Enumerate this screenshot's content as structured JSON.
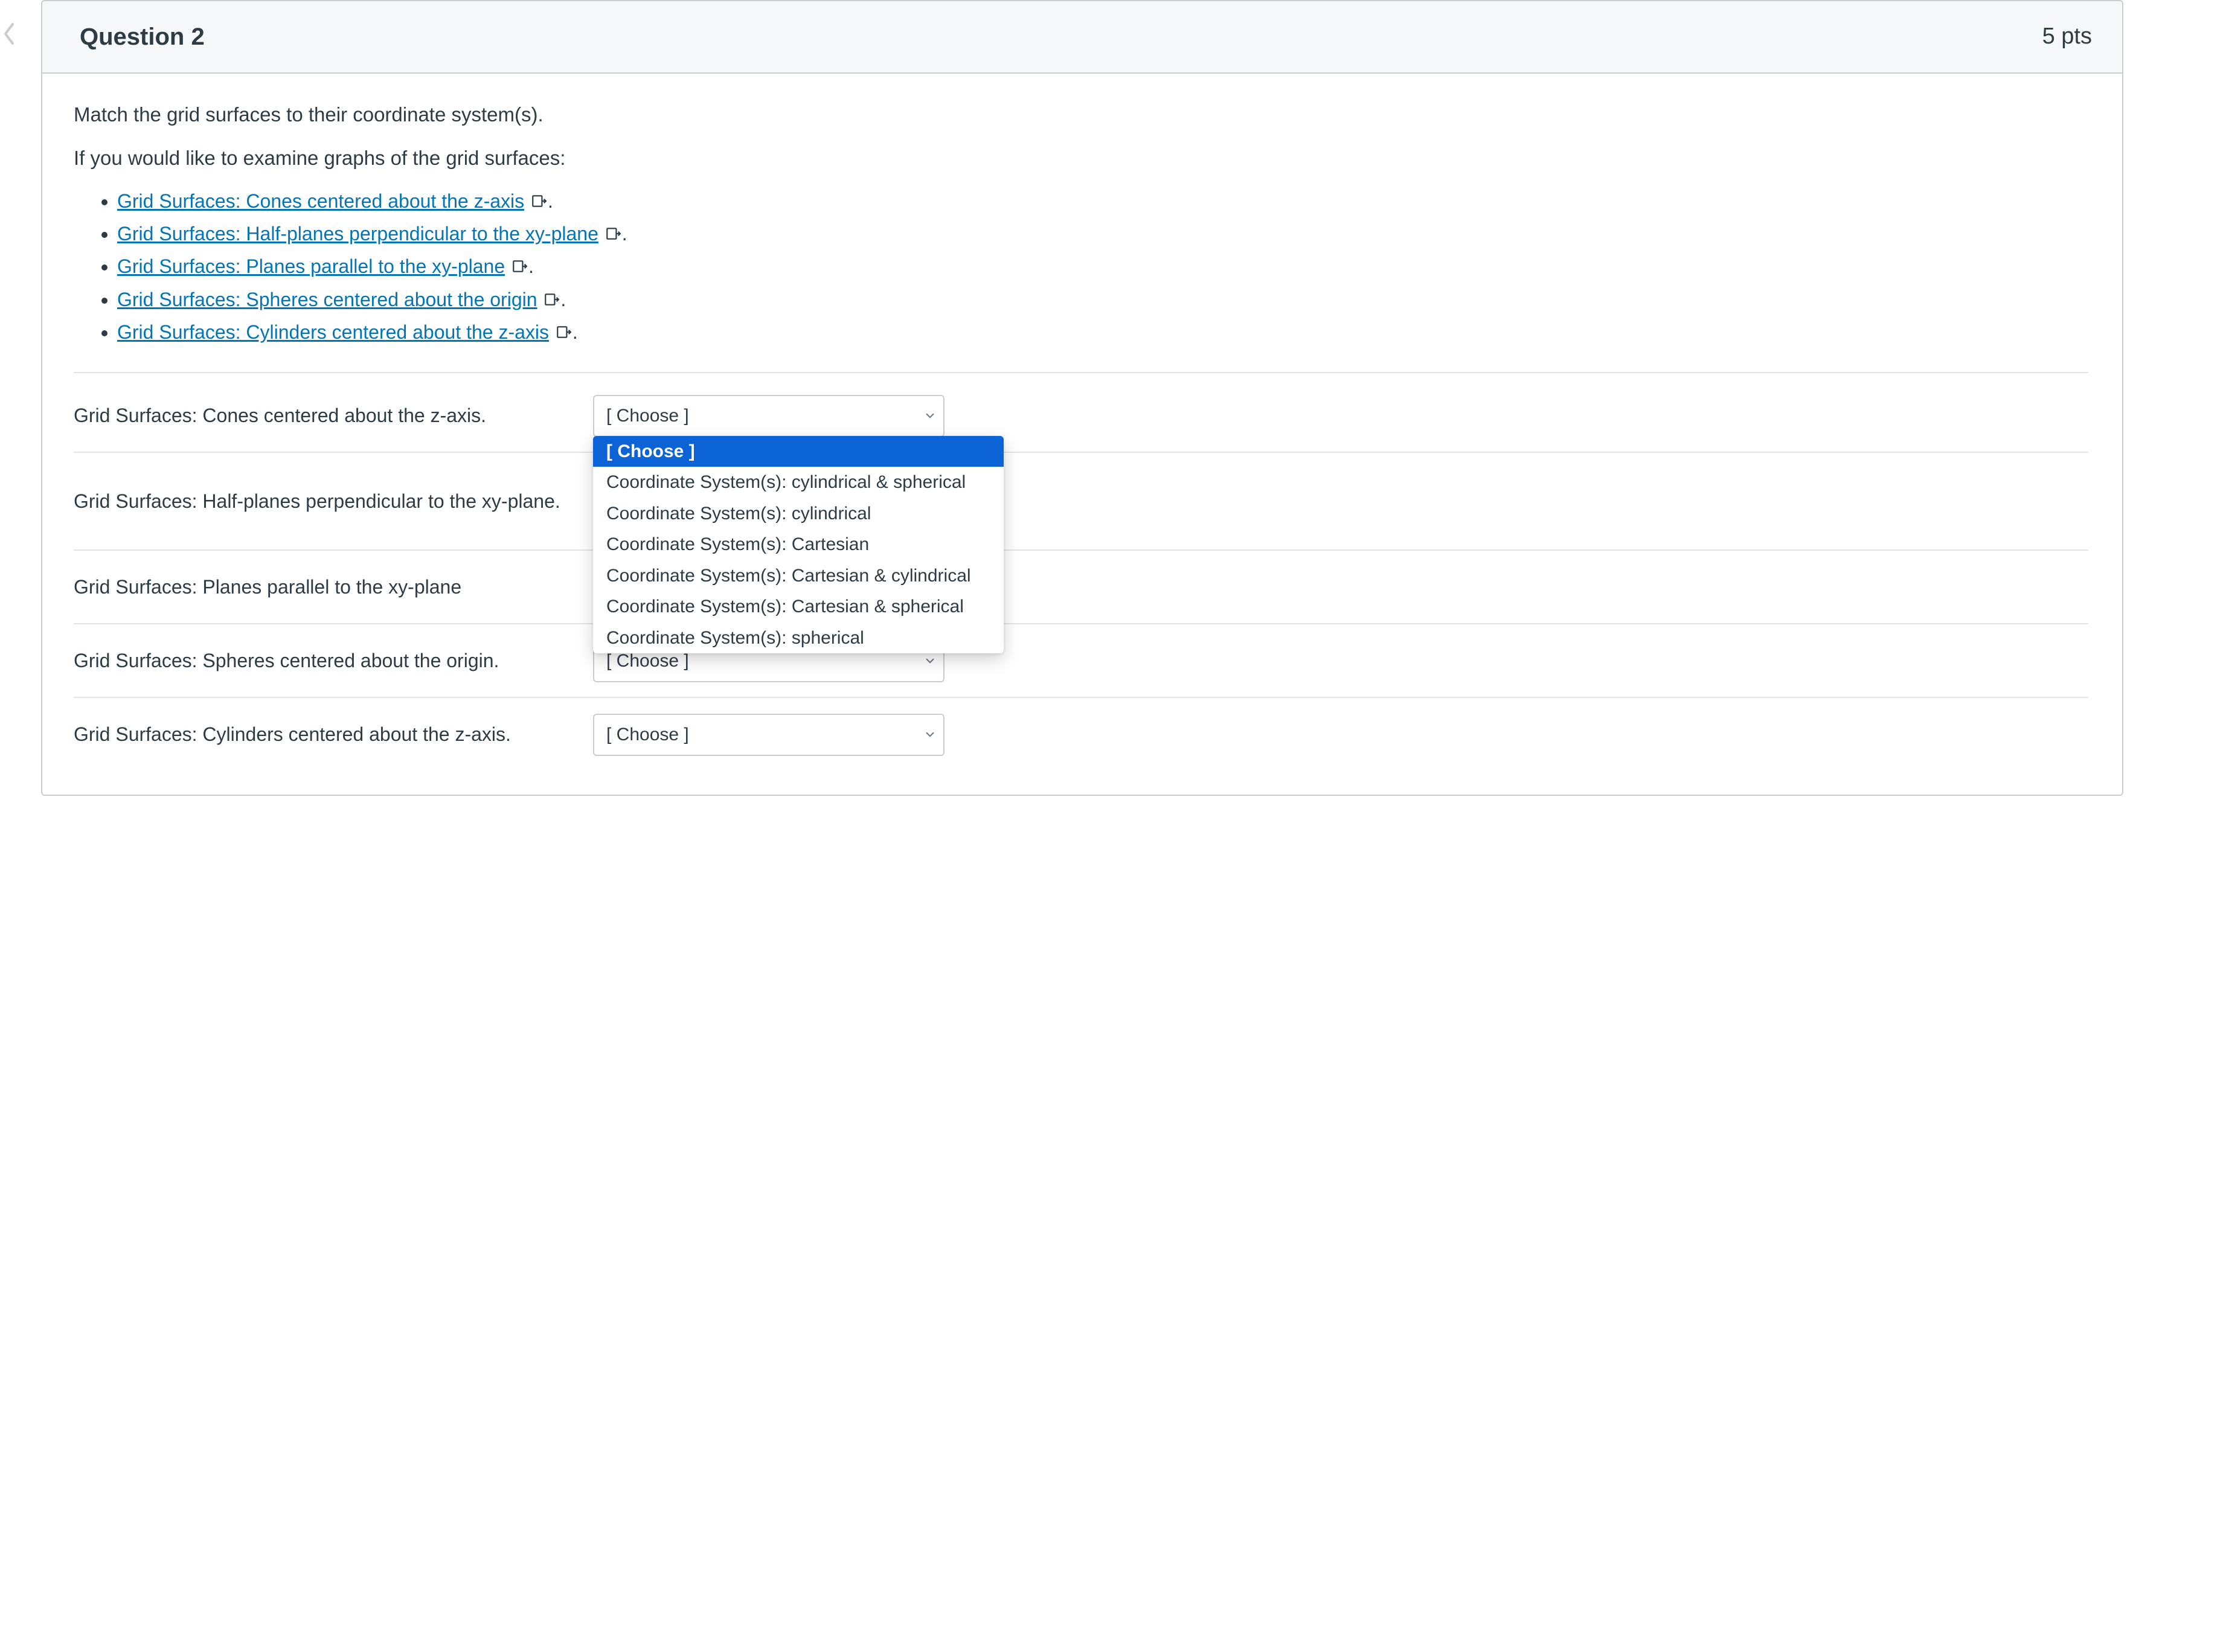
{
  "header": {
    "title": "Question 2",
    "points": "5 pts"
  },
  "instructions": {
    "line1": "Match the grid surfaces to their coordinate system(s).",
    "line2": "If you would like to examine graphs of the grid surfaces:"
  },
  "links": [
    "Grid Surfaces: Cones centered about the z-axis",
    "Grid Surfaces: Half-planes perpendicular to the xy-plane",
    "Grid Surfaces: Planes parallel to the xy-plane",
    "Grid Surfaces: Spheres centered about the origin",
    "Grid Surfaces: Cylinders centered about the z-axis"
  ],
  "link_suffix": ".",
  "choose_placeholder": "[ Choose ]",
  "dropdown_options": [
    "[ Choose ]",
    "Coordinate System(s): cylindrical & spherical",
    "Coordinate System(s): cylindrical",
    "Coordinate System(s): Cartesian",
    "Coordinate System(s): Cartesian & cylindrical",
    "Coordinate System(s): Cartesian & spherical",
    "Coordinate System(s): spherical"
  ],
  "match_rows": [
    {
      "label": "Grid Surfaces: Cones centered about the z-axis.",
      "open": true
    },
    {
      "label": "Grid Surfaces: Half-planes perpendicular to the xy-plane.",
      "open": false
    },
    {
      "label": "Grid Surfaces: Planes parallel to the xy-plane",
      "open": false
    },
    {
      "label": "Grid Surfaces: Spheres centered about the origin.",
      "open": false
    },
    {
      "label": "Grid Surfaces: Cylinders centered about the z-axis.",
      "open": false
    }
  ]
}
